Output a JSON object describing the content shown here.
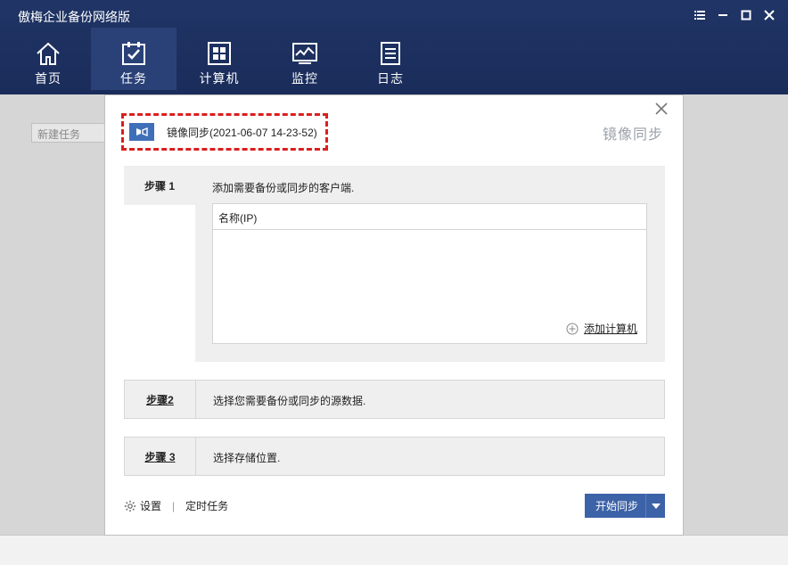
{
  "app": {
    "title": "傲梅企业备份网络版"
  },
  "nav": {
    "items": [
      {
        "label": "首页",
        "icon": "home-icon"
      },
      {
        "label": "任务",
        "icon": "task-checklist-icon"
      },
      {
        "label": "计算机",
        "icon": "computer-windows-icon"
      },
      {
        "label": "监控",
        "icon": "monitor-chart-icon"
      },
      {
        "label": "日志",
        "icon": "log-document-icon"
      }
    ],
    "active": "任务"
  },
  "background": {
    "new_task_label": "新建任务"
  },
  "dialog": {
    "heading": "镜像同步",
    "task_name": "镜像同步(2021-06-07 14-23-52)",
    "step1": {
      "tab": "步骤 1",
      "description": "添加需要备份或同步的客户端.",
      "table_header": "名称(IP)",
      "add_computer": "添加计算机"
    },
    "step2": {
      "tab": "步骤2",
      "description": "选择您需要备份或同步的源数据."
    },
    "step3": {
      "tab": "步骤 3",
      "description": "选择存储位置."
    },
    "footer": {
      "settings": "设置",
      "schedule": "定时任务",
      "start_button": "开始同步"
    }
  },
  "colors": {
    "appbar": "#1b2f5e",
    "nav_active": "#2a4178",
    "primary_button": "#3c63a7",
    "highlight_dashed": "#dc1e1e"
  }
}
